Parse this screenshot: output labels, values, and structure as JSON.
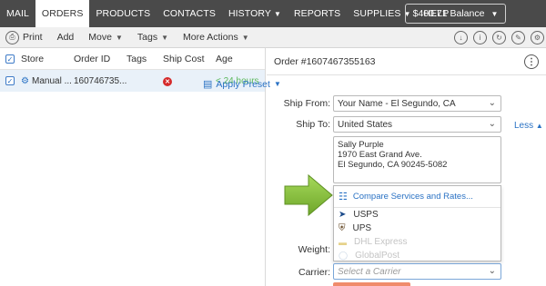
{
  "nav": {
    "items": [
      {
        "label": "MAIL",
        "active": false,
        "dropdown": false
      },
      {
        "label": "ORDERS",
        "active": true,
        "dropdown": false
      },
      {
        "label": "PRODUCTS",
        "active": false,
        "dropdown": false
      },
      {
        "label": "CONTACTS",
        "active": false,
        "dropdown": false
      },
      {
        "label": "HISTORY",
        "active": false,
        "dropdown": true
      },
      {
        "label": "REPORTS",
        "active": false,
        "dropdown": false
      },
      {
        "label": "SUPPLIES",
        "active": false,
        "dropdown": true
      },
      {
        "label": "HELP",
        "active": false,
        "dropdown": false
      }
    ],
    "balance": "$400.71 Balance",
    "background_color": "#4a4a4a"
  },
  "toolbar": {
    "print": "Print",
    "add": "Add",
    "move": "Move",
    "tags": "Tags",
    "more_actions": "More Actions",
    "right_icons": [
      "download-icon",
      "info-icon",
      "refresh-icon",
      "edit-icon",
      "settings-icon"
    ]
  },
  "orders_table": {
    "columns": [
      "Store",
      "Order ID",
      "Tags",
      "Ship Cost",
      "Age"
    ],
    "rows": [
      {
        "store": "Manual ...",
        "order_id": "160746735...",
        "tags": "",
        "ship_cost_status": "error",
        "age": "< 24 hours"
      }
    ]
  },
  "order_panel": {
    "title": "Order #1607467355163",
    "apply_preset": "Apply Preset",
    "ship_from_label": "Ship From:",
    "ship_from_value": "Your Name - El Segundo, CA",
    "ship_to_label": "Ship To:",
    "ship_to_value": "United States",
    "less_link": "Less",
    "address_line1": "Sally Purple",
    "address_line2": "1970 East Grand Ave.",
    "address_line3": "El Segundo, CA 90245-5082",
    "weight_label": "Weight:",
    "carrier_label": "Carrier:",
    "carrier_placeholder": "Select a Carrier",
    "carrier_dropdown": {
      "compare": "Compare Services and Rates...",
      "options": [
        {
          "label": "USPS",
          "enabled": true,
          "icon": "usps-eagle-icon"
        },
        {
          "label": "UPS",
          "enabled": true,
          "icon": "ups-shield-icon"
        },
        {
          "label": "DHL Express",
          "enabled": false,
          "icon": "dhl-icon"
        },
        {
          "label": "GlobalPost",
          "enabled": false,
          "icon": "globe-icon"
        }
      ]
    }
  },
  "colors": {
    "accent_blue": "#2a72c4",
    "row_selected": "#e9f1f9",
    "error_red": "#d52b2b",
    "age_green": "#5cb85c",
    "arrow_green": "#8cc63f"
  }
}
